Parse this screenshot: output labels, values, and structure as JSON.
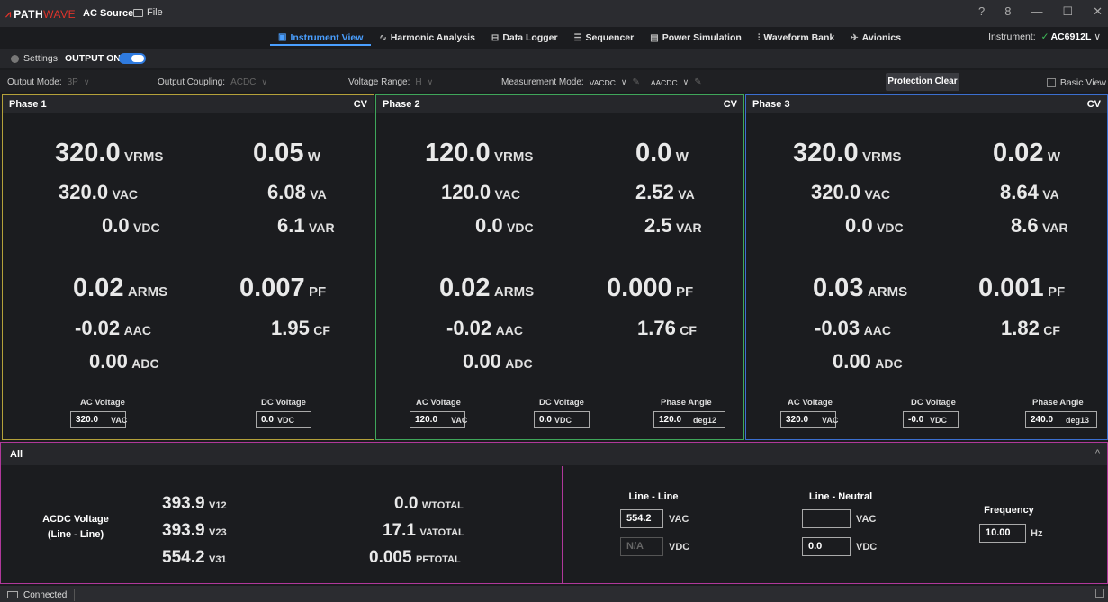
{
  "app": {
    "brand_path": "PATH",
    "brand_wave": "WAVE",
    "title": "AC Source",
    "file_menu": "File"
  },
  "window_controls": {
    "help": "?",
    "user": "8",
    "minimize": "—",
    "maximize": "☐",
    "close": "✕"
  },
  "nav": {
    "tabs": [
      {
        "label": "Instrument View",
        "icon": "instrument-view-icon",
        "active": true
      },
      {
        "label": "Harmonic Analysis",
        "icon": "harmonic-icon"
      },
      {
        "label": "Data Logger",
        "icon": "data-logger-icon"
      },
      {
        "label": "Sequencer",
        "icon": "sequencer-icon"
      },
      {
        "label": "Power Simulation",
        "icon": "power-simulation-icon"
      },
      {
        "label": "Waveform Bank",
        "icon": "waveform-bank-icon"
      },
      {
        "label": "Avionics",
        "icon": "avionics-icon"
      }
    ]
  },
  "instrument": {
    "label": "Instrument:",
    "status": "✓",
    "name": "AC6912L",
    "chevron": "∨"
  },
  "settings": {
    "label": "Settings",
    "output_label": "OUTPUT ON",
    "output_on": true
  },
  "config": {
    "output_mode_label": "Output Mode:",
    "output_mode": "3P",
    "output_coupling_label": "Output Coupling:",
    "output_coupling": "ACDC",
    "voltage_range_label": "Voltage Range:",
    "voltage_range": "H",
    "measurement_mode_label": "Measurement Mode:",
    "measurement_mode_v": "VACDC",
    "measurement_mode_a": "AACDC",
    "protection_clear": "Protection Clear",
    "basic_view": "Basic View"
  },
  "colors": {
    "phase1": "#b4a13a",
    "phase2": "#3fa65a",
    "phase3": "#3b6fd0",
    "all": "#b0389b",
    "accent": "#4a9fff"
  },
  "phases": [
    {
      "name": "Phase 1",
      "mode": "CV",
      "v_rms": "320.0",
      "v_ac": "320.0",
      "v_dc": "0.0",
      "w": "0.05",
      "va": "6.08",
      "var": "6.1",
      "a_rms": "0.02",
      "a_ac": "-0.02",
      "a_dc": "0.00",
      "pf": "0.007",
      "cf": "1.95",
      "ac_voltage_label": "AC Voltage",
      "ac_voltage": "320.0",
      "dc_voltage_label": "DC Voltage",
      "dc_voltage": "0.0"
    },
    {
      "name": "Phase 2",
      "mode": "CV",
      "v_rms": "120.0",
      "v_ac": "120.0",
      "v_dc": "0.0",
      "w": "0.0",
      "va": "2.52",
      "var": "2.5",
      "a_rms": "0.02",
      "a_ac": "-0.02",
      "a_dc": "0.00",
      "pf": "0.000",
      "cf": "1.76",
      "ac_voltage_label": "AC Voltage",
      "ac_voltage": "120.0",
      "dc_voltage_label": "DC Voltage",
      "dc_voltage": "0.0",
      "phase_angle_label": "Phase Angle",
      "phase_angle": "120.0",
      "phase_angle_unit": "deg12"
    },
    {
      "name": "Phase 3",
      "mode": "CV",
      "v_rms": "320.0",
      "v_ac": "320.0",
      "v_dc": "0.0",
      "w": "0.02",
      "va": "8.64",
      "var": "8.6",
      "a_rms": "0.03",
      "a_ac": "-0.03",
      "a_dc": "0.00",
      "pf": "0.001",
      "cf": "1.82",
      "ac_voltage_label": "AC Voltage",
      "ac_voltage": "320.0",
      "dc_voltage_label": "DC Voltage",
      "dc_voltage": "-0.0",
      "phase_angle_label": "Phase Angle",
      "phase_angle": "240.0",
      "phase_angle_unit": "deg13"
    }
  ],
  "units": {
    "vrms": "VRMS",
    "vac": "VAC",
    "vdc": "VDC",
    "w": "W",
    "va": "VA",
    "var": "VAR",
    "arms": "ARMS",
    "aac": "AAC",
    "adc": "ADC",
    "pf": "PF",
    "cf": "CF"
  },
  "all": {
    "title": "All",
    "collapse": "^",
    "acdc_voltage_label": "ACDC Voltage",
    "acdc_voltage_sub": "(Line - Line)",
    "v12": "393.9",
    "v12_unit": "V12",
    "v23": "393.9",
    "v23_unit": "V23",
    "v31": "554.2",
    "v31_unit": "V31",
    "w_total": "0.0",
    "w_total_unit": "WTOTAL",
    "va_total": "17.1",
    "va_total_unit": "VATOTAL",
    "pf_total": "0.005",
    "pf_total_unit": "PFTOTAL",
    "line_line_label": "Line - Line",
    "line_line_ac": "554.2",
    "line_line_ac_unit": "VAC",
    "line_line_dc": "N/A",
    "line_line_dc_unit": "VDC",
    "line_neutral_label": "Line - Neutral",
    "line_neutral_ac": "",
    "line_neutral_ac_unit": "VAC",
    "line_neutral_dc": "0.0",
    "line_neutral_dc_unit": "VDC",
    "frequency_label": "Frequency",
    "frequency": "10.00",
    "frequency_unit": "Hz"
  },
  "status": {
    "text": "Connected"
  }
}
